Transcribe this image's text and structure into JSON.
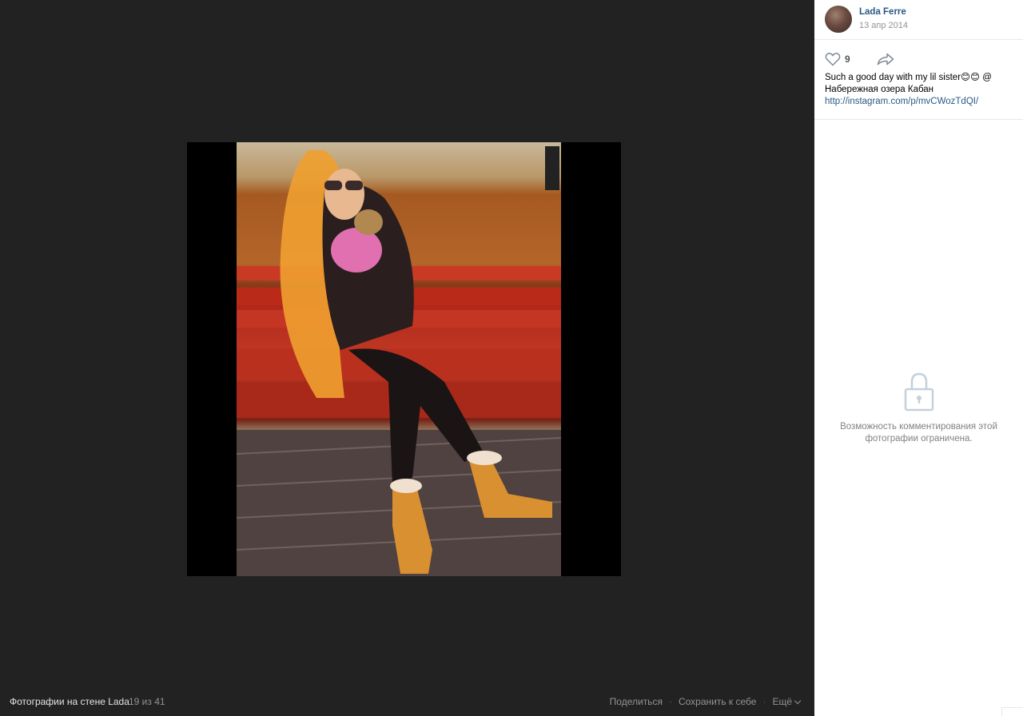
{
  "photo_viewer": {
    "album_title": "Фотографии на стене Lada",
    "counter": "19 из 41",
    "actions": {
      "share": "Поделиться",
      "save": "Сохранить к себе",
      "more": "Ещё"
    }
  },
  "post": {
    "author_name": "Lada Ferre",
    "date": "13 апр 2014",
    "likes": "9",
    "description_line1": "Such a good day with my lil sister😊😊 @",
    "description_line2": "Набережная озера Кабан",
    "link": "http://instagram.com/p/mvCWozTdQI/"
  },
  "comments": {
    "restricted_line1": "Возможность комментирования этой",
    "restricted_line2": "фотографии ограничена."
  },
  "icons": {
    "like": "heart-icon",
    "share": "share-arrow-icon",
    "lock": "lock-icon",
    "more": "chevron-down-icon"
  },
  "colors": {
    "viewer_bg": "#222222",
    "link": "#2a5885",
    "muted": "#939393"
  }
}
